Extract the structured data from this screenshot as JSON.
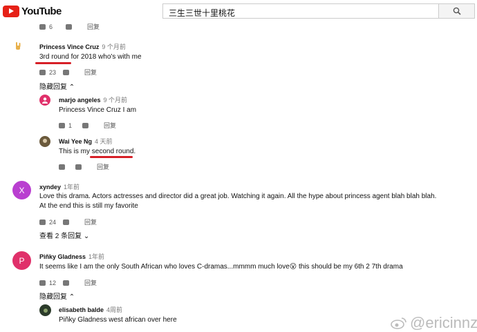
{
  "header": {
    "brand": "YouTube",
    "search_value": "三生三世十里桃花",
    "search_icon": "search-icon"
  },
  "top_partial": {
    "likes": "6",
    "reply": "回复"
  },
  "comments": [
    {
      "author": "Princess Vince Cruz",
      "time": "9 个月前",
      "text": "3rd round for 2018 who's with me",
      "likes": "23",
      "reply": "回复",
      "toggle": "隐藏回复",
      "replies": [
        {
          "author": "marjo angeles",
          "time": "9 个月前",
          "text": "Princess Vince Cruz I am",
          "likes": "1",
          "reply": "回复"
        },
        {
          "author": "Wai Yee Ng",
          "time": "4 天前",
          "text": "This is my second round.",
          "likes": "",
          "reply": "回复"
        }
      ]
    },
    {
      "author": "xyndey",
      "time": "1年前",
      "avatar_letter": "X",
      "text1": "Love this drama. Actors actresses and director did a great job. Watching it again. All the hype about princess agent blah blah blah.",
      "text2": "At the end this is still my favorite",
      "likes": "24",
      "reply": "回复",
      "toggle": "查看 2 条回复"
    },
    {
      "author": "Piñky Gladness",
      "time": "1年前",
      "avatar_letter": "P",
      "text": "It seems like I am the only South African who loves C-dramas...mmmm much love😮 this should be my 6th 2 7th drama",
      "likes": "12",
      "reply": "回复",
      "toggle": "隐藏回复",
      "replies": [
        {
          "author": "elisabeth balde",
          "time": "4周前",
          "text": "Piñky Gladness west african over here"
        }
      ]
    }
  ],
  "watermark": "@ericinnz",
  "colors": {
    "accent_red": "#d61f26",
    "avatar_purple": "#b93fd0",
    "avatar_pink": "#e0306a"
  }
}
